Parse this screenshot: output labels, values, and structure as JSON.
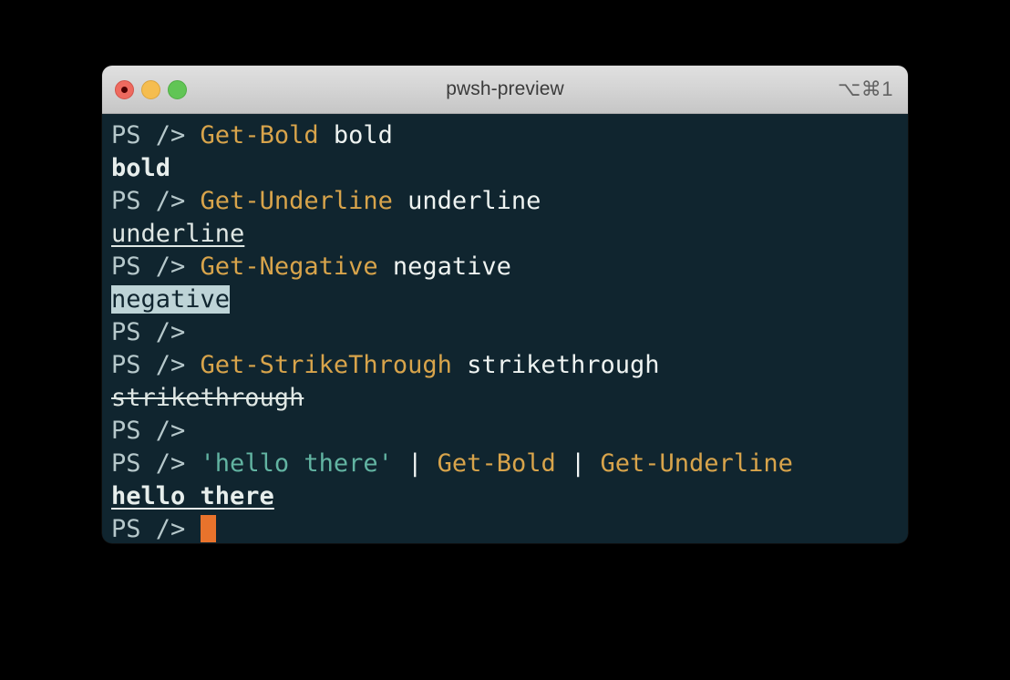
{
  "window": {
    "title": "pwsh-preview",
    "shortcut": "⌥⌘1",
    "traffic_lights": {
      "close_label": "close",
      "minimize_label": "minimize",
      "maximize_label": "maximize"
    },
    "colors": {
      "terminal_background": "#10252f",
      "titlebar_background": "#d4d4d4",
      "prompt": "#b6c8cb",
      "command": "#d8a44b",
      "argument": "#eef3f1",
      "string": "#62b4a2",
      "pipe": "#f2f6f5",
      "output": "#dfe7e4",
      "negative_background": "#bed4d7",
      "cursor": "#e8732c",
      "close_button": "#ee6a5f",
      "minimize_button": "#f5bd4f",
      "maximize_button": "#61c555"
    }
  },
  "terminal": {
    "prompt_text": "PS /> ",
    "prompt_text_empty": "PS />",
    "lines": [
      {
        "kind": "input",
        "prompt": "PS /> ",
        "command": "Get-Bold",
        "space": " ",
        "argument": "bold"
      },
      {
        "kind": "output",
        "style": "bold",
        "text": "bold"
      },
      {
        "kind": "input",
        "prompt": "PS /> ",
        "command": "Get-Underline",
        "space": " ",
        "argument": "underline"
      },
      {
        "kind": "output",
        "style": "underline",
        "text": "underline"
      },
      {
        "kind": "input",
        "prompt": "PS /> ",
        "command": "Get-Negative",
        "space": " ",
        "argument": "negative"
      },
      {
        "kind": "output",
        "style": "negative",
        "text": "negative"
      },
      {
        "kind": "input-empty",
        "prompt": "PS />"
      },
      {
        "kind": "input",
        "prompt": "PS /> ",
        "command": "Get-StrikeThrough",
        "space": " ",
        "argument": "strikethrough"
      },
      {
        "kind": "output",
        "style": "strikethrough",
        "text": "strikethrough"
      },
      {
        "kind": "input-empty",
        "prompt": "PS />"
      },
      {
        "kind": "pipeline",
        "prompt": "PS /> ",
        "string": "'hello there'",
        "sep1": " ",
        "pipe1": "|",
        "sep2": " ",
        "command1": "Get-Bold",
        "sep3": " ",
        "pipe2": "|",
        "sep4": " ",
        "command2": "Get-Underline"
      },
      {
        "kind": "output",
        "style": "bold-underline",
        "text": "hello there"
      },
      {
        "kind": "input-cursor",
        "prompt": "PS /> "
      }
    ]
  }
}
